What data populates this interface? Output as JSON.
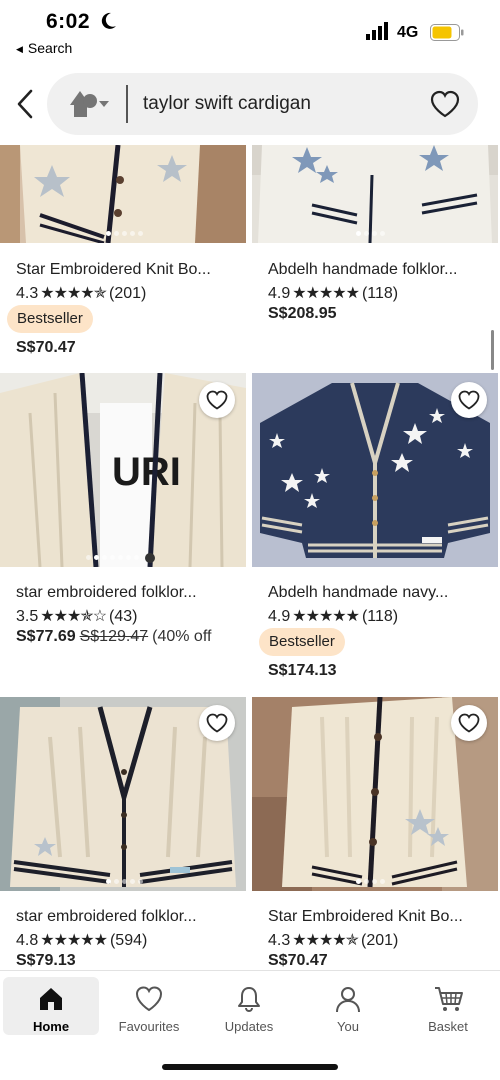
{
  "status_bar": {
    "time": "6:02",
    "back_label": "Search",
    "network": "4G"
  },
  "header": {
    "query": "taylor swift cardigan"
  },
  "products": [
    {
      "title": "Star Embroidered Knit Bo...",
      "rating": "4.3",
      "stars": "★★★★✯",
      "reviews": "(201)",
      "badge": "Bestseller",
      "price": "S$70.47",
      "old_price": "",
      "discount": ""
    },
    {
      "title": "Abdelh handmade folklor...",
      "rating": "4.9",
      "stars": "★★★★★",
      "reviews": "(118)",
      "badge": "",
      "price": "S$208.95",
      "old_price": "",
      "discount": ""
    },
    {
      "title": "star embroidered folklor...",
      "rating": "3.5",
      "stars": "★★★✯☆",
      "reviews": "(43)",
      "badge": "",
      "price": "S$77.69",
      "old_price": "S$129.47",
      "discount": "(40% off"
    },
    {
      "title": "Abdelh handmade navy...",
      "rating": "4.9",
      "stars": "★★★★★",
      "reviews": "(118)",
      "badge": "Bestseller",
      "price": "S$174.13",
      "old_price": "",
      "discount": ""
    },
    {
      "title": "star embroidered folklor...",
      "rating": "4.8",
      "stars": "★★★★★",
      "reviews": "(594)",
      "badge": "",
      "price": "S$79.13",
      "old_price": "",
      "discount": ""
    },
    {
      "title": "Star Embroidered Knit Bo...",
      "rating": "4.3",
      "stars": "★★★★✯",
      "reviews": "(201)",
      "badge": "",
      "price": "S$70.47",
      "old_price": "",
      "discount": ""
    }
  ],
  "bottom_nav": [
    {
      "label": "Home",
      "icon": "home-icon",
      "active": true
    },
    {
      "label": "Favourites",
      "icon": "heart-icon",
      "active": false
    },
    {
      "label": "Updates",
      "icon": "bell-icon",
      "active": false
    },
    {
      "label": "You",
      "icon": "person-icon",
      "active": false
    },
    {
      "label": "Basket",
      "icon": "basket-icon",
      "active": false
    }
  ],
  "colors": {
    "accent_badge": "#fde4c8",
    "navy_cardigan": "#2c3a5c",
    "cream_cardigan": "#efe7d6",
    "star_blue": "#7f98b9"
  }
}
